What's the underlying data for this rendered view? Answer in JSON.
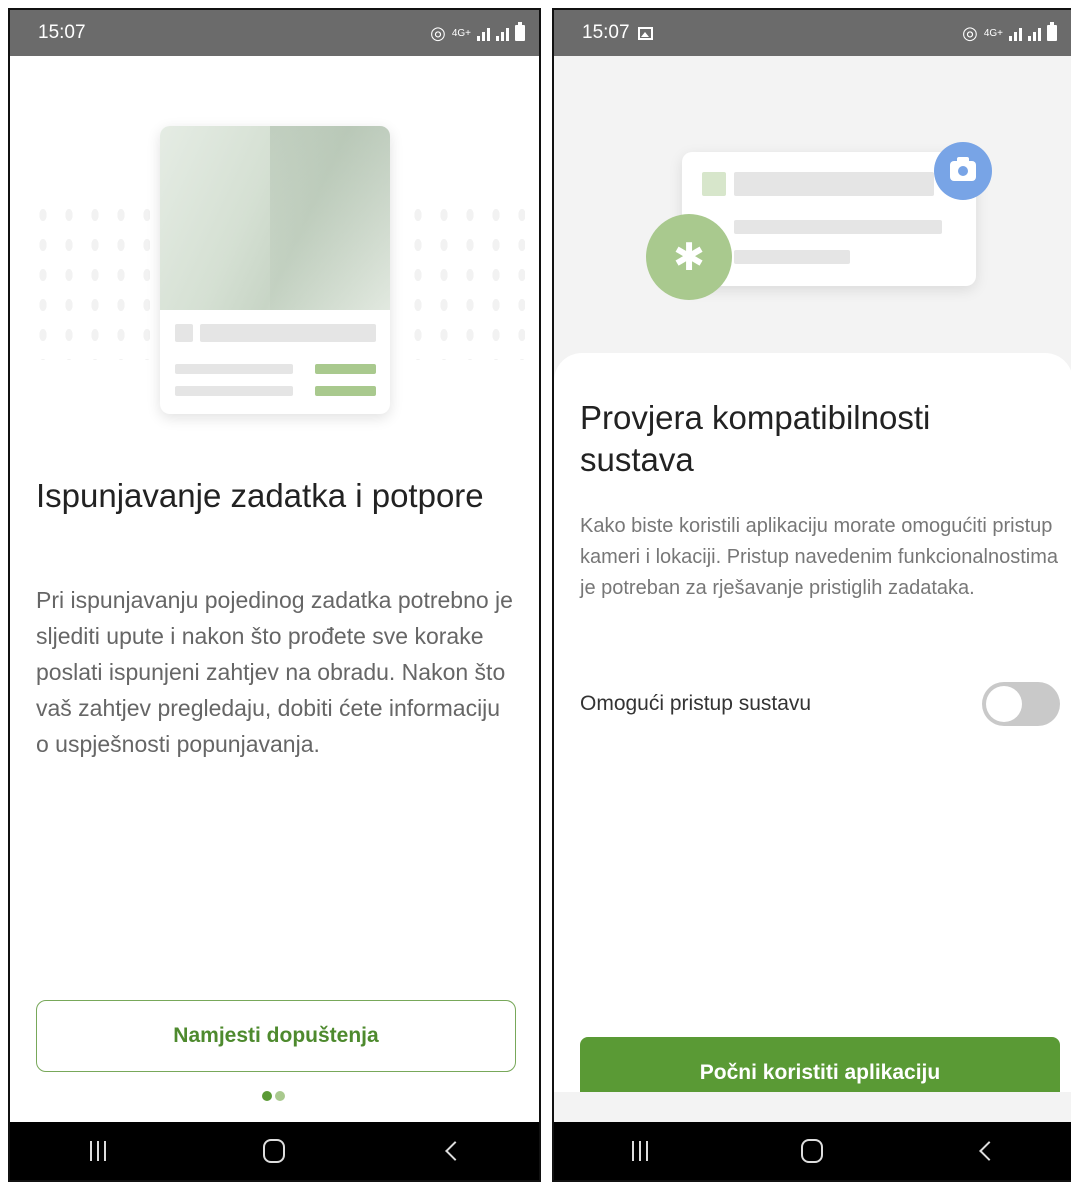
{
  "left_screen": {
    "status": {
      "time": "15:07",
      "network": "4G+"
    },
    "title": "Ispunjavanje zadatka i potpore",
    "body": "Pri ispunjavanju pojedinog zadatka potrebno je sljediti upute i nakon što prođete sve korake poslati ispunjeni zahtjev na obradu. Nakon što vaš zahtjev pregledaju, dobiti ćete informaciju o uspješnosti popunjavanja.",
    "button_label": "Namjesti dopuštenja",
    "page_indicator": {
      "pages": 2,
      "active": 1
    }
  },
  "right_screen": {
    "status": {
      "time": "15:07",
      "network": "4G+"
    },
    "title": "Provjera kompatibilnosti sustava",
    "body": "Kako biste koristili aplikaciju morate omogućiti pristup kameri i lokaciji. Pristup navedenim funkcionalnostima je potreban za rješavanje pristiglih zadataka.",
    "toggle": {
      "label": "Omogući pristup sustavu",
      "enabled": false
    },
    "button_label": "Počni koristiti aplikaciju"
  },
  "colors": {
    "accent_green": "#5a9a35",
    "light_green": "#a9c98e",
    "camera_blue": "#78a4e6",
    "status_bar": "#6b6b6b"
  },
  "icons": {
    "status": [
      "hotspot-icon",
      "signal-icon",
      "battery-icon",
      "gallery-icon"
    ],
    "nav": [
      "recent-apps-icon",
      "home-icon",
      "back-icon"
    ],
    "illustration": [
      "camera-icon",
      "gear-icon"
    ]
  }
}
